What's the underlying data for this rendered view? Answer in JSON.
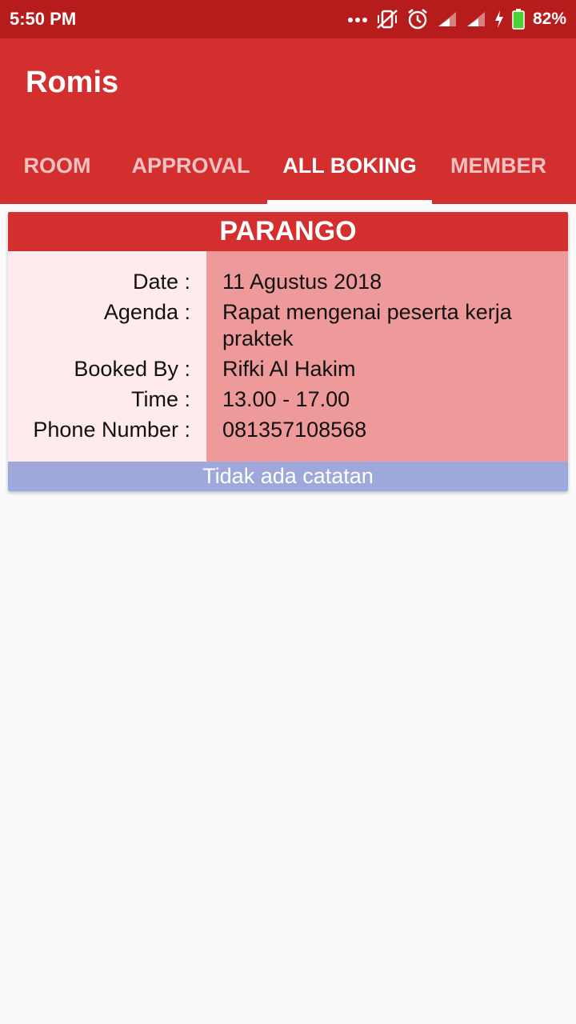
{
  "status_bar": {
    "time": "5:50 PM",
    "battery": "82%",
    "icons": [
      "more-dots-icon",
      "vibrate-off-icon",
      "alarm-icon",
      "signal-icon",
      "signal-icon",
      "charging-icon",
      "battery-icon"
    ]
  },
  "app": {
    "title": "Romis"
  },
  "tabs": [
    {
      "label": "ROOM",
      "active": false
    },
    {
      "label": "APPROVAL",
      "active": false
    },
    {
      "label": "ALL BOKING",
      "active": true
    },
    {
      "label": "MEMBER",
      "active": false
    }
  ],
  "booking": {
    "room": "PARANGO",
    "labels": {
      "date": "Date :",
      "agenda": "Agenda :",
      "booked_by": "Booked By :",
      "time": "Time :",
      "phone": "Phone Number :"
    },
    "values": {
      "date": "11 Agustus 2018",
      "agenda": "Rapat mengenai peserta kerja praktek",
      "booked_by": "Rifki Al Hakim",
      "time": "13.00 - 17.00",
      "phone": "081357108568"
    },
    "note": "Tidak ada catatan"
  },
  "colors": {
    "status_bar": "#b71c1c",
    "primary": "#d32f2f",
    "label_bg": "#ffebee",
    "value_bg": "#ef9a9a",
    "note_bg": "#9fa8da"
  }
}
